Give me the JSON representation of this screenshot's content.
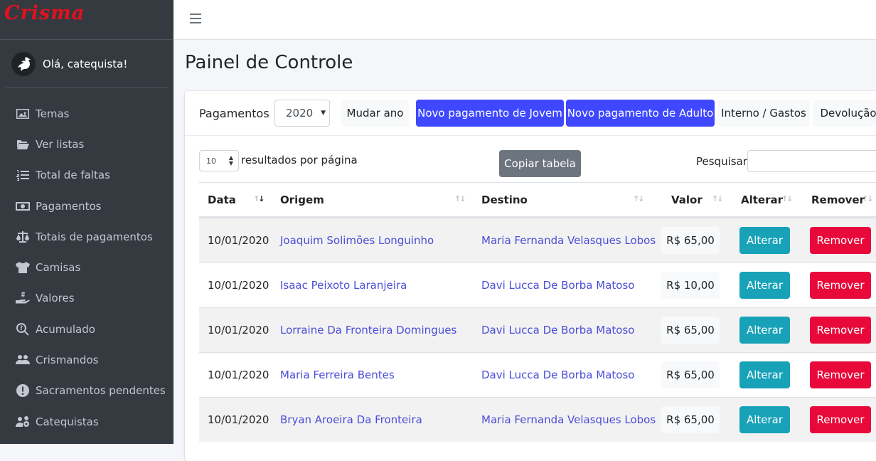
{
  "brand": {
    "name": "Crisma"
  },
  "user": {
    "greeting": "Olá, catequista!"
  },
  "sidebar": {
    "items": [
      {
        "label": "Temas",
        "icon": "image-icon"
      },
      {
        "label": "Ver listas",
        "icon": "folder-open-icon"
      },
      {
        "label": "Total de faltas",
        "icon": "list-ol-icon"
      },
      {
        "label": "Pagamentos",
        "icon": "money-bill-icon"
      },
      {
        "label": "Totais de pagamentos",
        "icon": "balance-scale-icon"
      },
      {
        "label": "Camisas",
        "icon": "tshirt-icon"
      },
      {
        "label": "Valores",
        "icon": "hand-holding-dollar-icon"
      },
      {
        "label": "Acumulado",
        "icon": "search-dollar-icon"
      },
      {
        "label": "Crismandos",
        "icon": "users-icon"
      },
      {
        "label": "Sacramentos pendentes",
        "icon": "exclamation-circle-icon"
      },
      {
        "label": "Catequistas",
        "icon": "users-cog-icon"
      }
    ]
  },
  "page": {
    "title": "Painel de Controle"
  },
  "header": {
    "label": "Pagamentos",
    "year": "2020",
    "buttons": {
      "change_year": "Mudar ano",
      "new_youth": "Novo pagamento de Jovem",
      "new_adult": "Novo pagamento de Adulto",
      "internal": "Interno / Gastos",
      "refund": "Devolução"
    }
  },
  "table_controls": {
    "page_length": "10",
    "page_length_text": "resultados por página",
    "copy": "Copiar tabela",
    "search_label": "Pesquisar"
  },
  "table": {
    "columns": [
      "Data",
      "Origem",
      "Destino",
      "Valor",
      "Alterar",
      "Remover"
    ],
    "rows": [
      {
        "data": "10/01/2020",
        "origem": "Joaquim Solimões Longuinho",
        "destino": "Maria Fernanda Velasques Lobos",
        "valor": "R$ 65,00",
        "alterar": "Alterar",
        "remover": "Remover"
      },
      {
        "data": "10/01/2020",
        "origem": "Isaac Peixoto Laranjeira",
        "destino": "Davi Lucca De Borba Matoso",
        "valor": "R$ 10,00",
        "alterar": "Alterar",
        "remover": "Remover"
      },
      {
        "data": "10/01/2020",
        "origem": "Lorraine Da Fronteira Domingues",
        "destino": "Davi Lucca De Borba Matoso",
        "valor": "R$ 65,00",
        "alterar": "Alterar",
        "remover": "Remover"
      },
      {
        "data": "10/01/2020",
        "origem": "Maria Ferreira Bentes",
        "destino": "Davi Lucca De Borba Matoso",
        "valor": "R$ 65,00",
        "alterar": "Alterar",
        "remover": "Remover"
      },
      {
        "data": "10/01/2020",
        "origem": "Bryan Aroeira Da Fronteira",
        "destino": "Maria Fernanda Velasques Lobos",
        "valor": "R$ 65,00",
        "alterar": "Alterar",
        "remover": "Remover"
      }
    ]
  },
  "colors": {
    "primary": "#3f48ff",
    "info": "#17a2b8",
    "danger": "#e8093a",
    "sidebar": "#343a40",
    "brand": "#e5101e"
  }
}
